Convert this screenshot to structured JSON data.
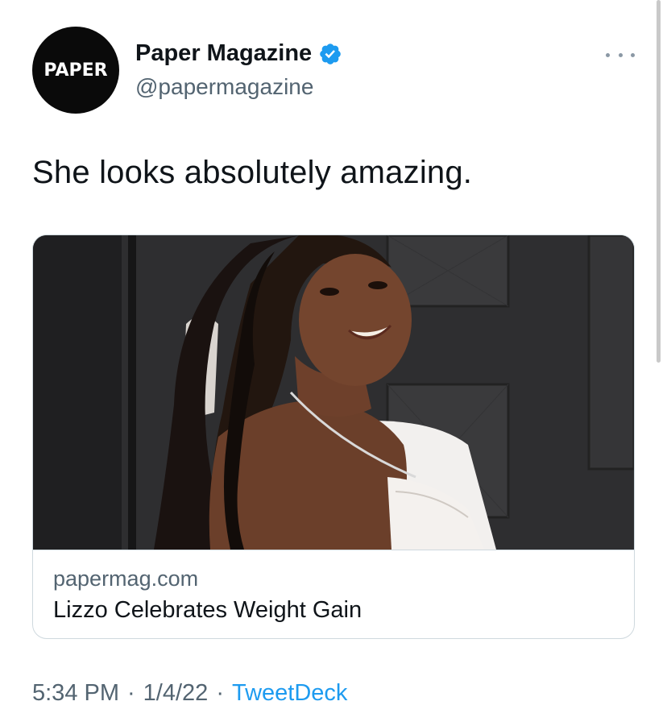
{
  "tweet": {
    "avatar_text": "PAPER",
    "display_name": "Paper Magazine",
    "verified_icon": "verified-badge-icon",
    "handle": "@papermagazine",
    "more_icon": "more-horizontal-icon",
    "text": "She looks absolutely amazing."
  },
  "card": {
    "domain": "papermag.com",
    "title": "Lizzo Celebrates Weight Gain"
  },
  "meta": {
    "time": "5:34 PM",
    "separator": "·",
    "date": "1/4/22",
    "source": "TweetDeck"
  },
  "colors": {
    "accent": "#1d9bf0",
    "secondary_text": "#536471",
    "primary_text": "#0f1419",
    "avatar_bg": "#0a0a0a",
    "border": "#cfd9de"
  }
}
